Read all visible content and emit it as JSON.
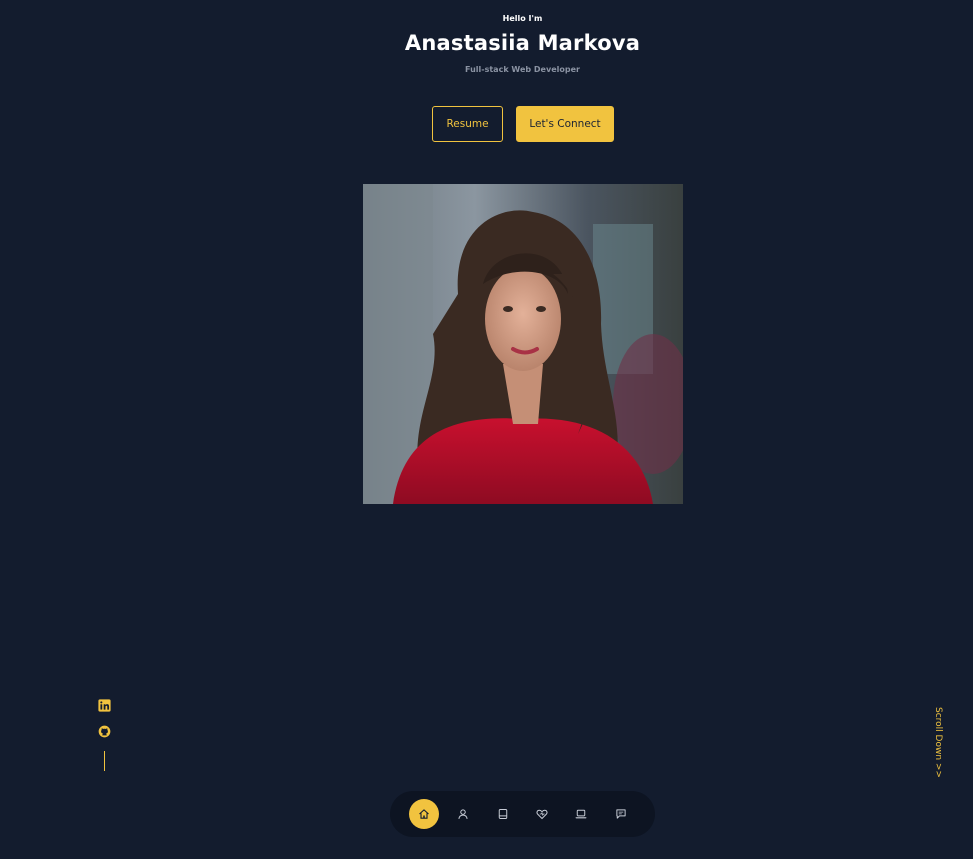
{
  "hero": {
    "greeting": "Hello I'm",
    "name": "Anastasiia Markova",
    "role": "Full-stack Web Developer"
  },
  "buttons": {
    "resume": "Resume",
    "connect": "Let's Connect"
  },
  "photo": {
    "alt": "Portrait of Anastasiia Markova"
  },
  "socials": [
    {
      "name": "linkedin-icon"
    },
    {
      "name": "github-icon"
    }
  ],
  "scroll": {
    "label": "Scroll Down >>"
  },
  "nav": {
    "items": [
      {
        "icon": "home-icon",
        "active": true
      },
      {
        "icon": "user-icon",
        "active": false
      },
      {
        "icon": "book-icon",
        "active": false
      },
      {
        "icon": "services-icon",
        "active": false
      },
      {
        "icon": "laptop-icon",
        "active": false
      },
      {
        "icon": "message-icon",
        "active": false
      }
    ]
  },
  "colors": {
    "background": "#131c2e",
    "accent": "#f1c33f",
    "nav_background": "#0d1422",
    "muted_text": "#8b93a3"
  }
}
